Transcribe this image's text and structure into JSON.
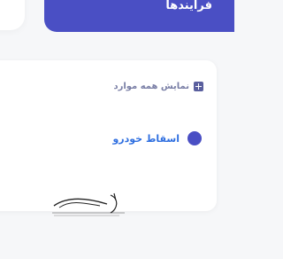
{
  "header": {
    "processes_label": "فرایندها"
  },
  "panel": {
    "show_all_label": "نمایش همه موارد",
    "items": [
      {
        "label": "اسقاط خودرو"
      }
    ]
  },
  "colors": {
    "accent": "#4a4fc4",
    "link": "#2f6fe0",
    "muted": "#7a7fa6"
  },
  "icons": {
    "show_all": "plus-square-icon",
    "item": "bullet-dot-icon",
    "watermark": "watermark-logo"
  }
}
